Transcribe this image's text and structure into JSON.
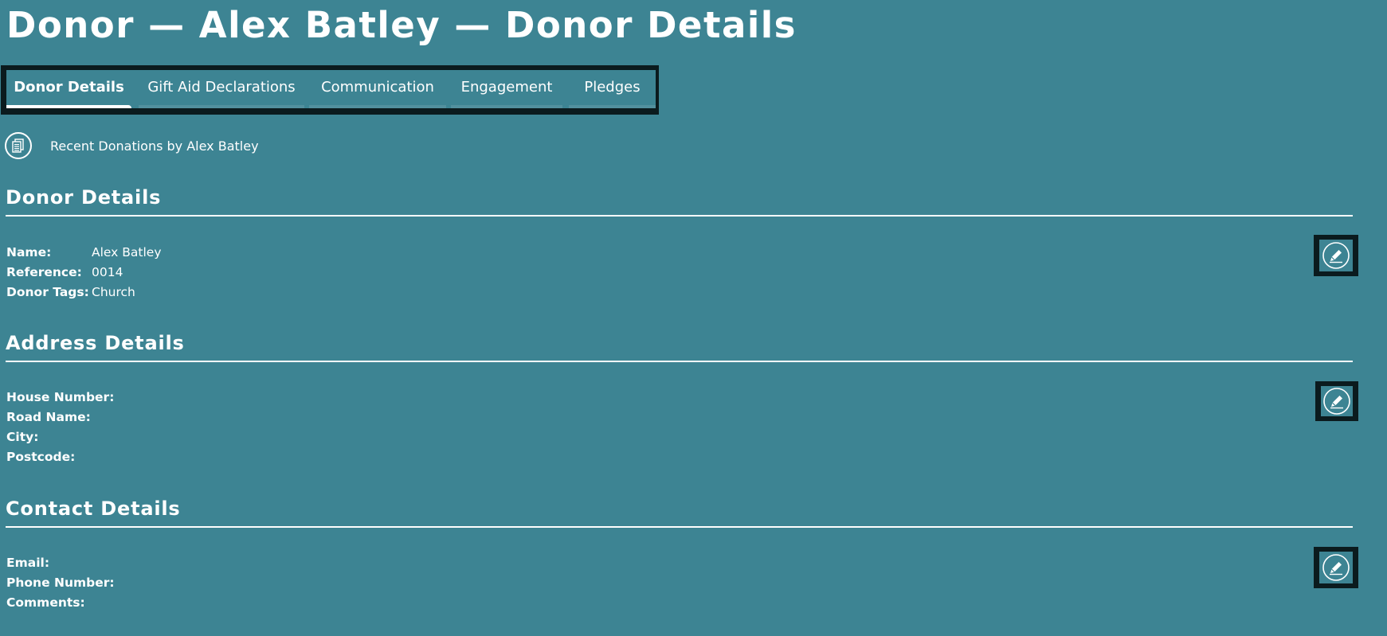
{
  "page": {
    "title": "Donor — Alex Batley — Donor Details"
  },
  "tabs": [
    {
      "label": "Donor Details",
      "active": true
    },
    {
      "label": "Gift Aid Declarations",
      "active": false
    },
    {
      "label": "Communication",
      "active": false
    },
    {
      "label": "Engagement",
      "active": false
    },
    {
      "label": "Pledges",
      "active": false
    }
  ],
  "recent_donations": {
    "label": "Recent Donations by Alex Batley",
    "icon": "documents-icon"
  },
  "sections": {
    "donor": {
      "title": "Donor Details",
      "edit_icon": "pencil-icon",
      "fields": [
        {
          "label": "Name:",
          "value": "Alex Batley"
        },
        {
          "label": "Reference:",
          "value": "0014"
        },
        {
          "label": "Donor Tags:",
          "value": "Church"
        }
      ]
    },
    "address": {
      "title": "Address Details",
      "edit_icon": "pencil-icon",
      "fields": [
        {
          "label": "House Number:",
          "value": ""
        },
        {
          "label": "Road Name:",
          "value": ""
        },
        {
          "label": "City:",
          "value": ""
        },
        {
          "label": "Postcode:",
          "value": ""
        }
      ]
    },
    "contact": {
      "title": "Contact Details",
      "edit_icon": "pencil-icon",
      "fields": [
        {
          "label": "Email:",
          "value": ""
        },
        {
          "label": "Phone Number:",
          "value": ""
        },
        {
          "label": "Comments:",
          "value": ""
        }
      ]
    }
  },
  "colors": {
    "background": "#3d8493",
    "frame": "#0b1b1e",
    "text": "#ffffff"
  }
}
